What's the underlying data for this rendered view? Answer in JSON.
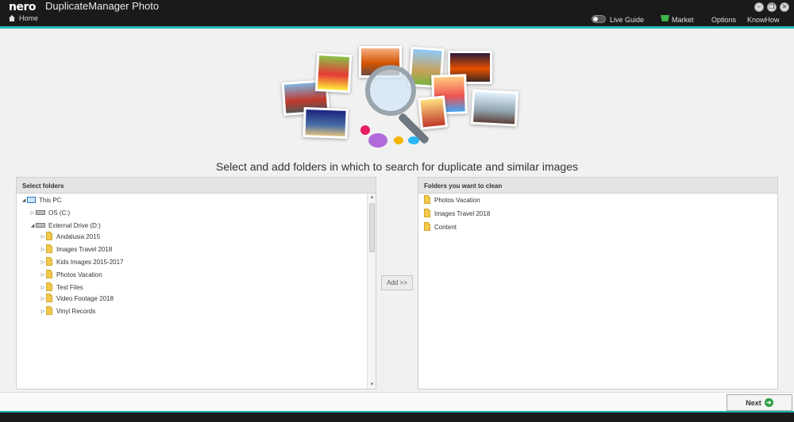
{
  "app": {
    "brand": "nero",
    "title": "DuplicateManager Photo",
    "home_label": "Home"
  },
  "menu": {
    "live_guide": "Live Guide",
    "market": "Market",
    "options": "Options",
    "knowhow": "KnowHow"
  },
  "window_controls": {
    "minimize": "–",
    "restore": "❐",
    "close": "✕"
  },
  "headline": "Select and add folders in which to search for duplicate and similar images",
  "left_panel": {
    "title": "Select folders",
    "tree": [
      {
        "label": "This PC",
        "icon": "computer-icon"
      },
      {
        "label": "OS (C:)",
        "icon": "drive-icon"
      },
      {
        "label": "External Drive (D:)",
        "icon": "drive-icon"
      },
      {
        "label": "Andalusia 2015",
        "icon": "folder-icon"
      },
      {
        "label": "Images Travel 2018",
        "icon": "folder-icon"
      },
      {
        "label": "Kids Images 2015-2017",
        "icon": "folder-icon"
      },
      {
        "label": "Photos Vacation",
        "icon": "folder-icon"
      },
      {
        "label": "Test Files",
        "icon": "folder-icon"
      },
      {
        "label": "Video Footage 2018",
        "icon": "folder-icon"
      },
      {
        "label": "Vinyl Records",
        "icon": "folder-icon"
      }
    ]
  },
  "add_button": "Add >>",
  "right_panel": {
    "title": "Folders you want to clean",
    "items": [
      {
        "label": "Photos Vacation"
      },
      {
        "label": "Images Travel 2018"
      },
      {
        "label": "Content"
      }
    ]
  },
  "footer": {
    "next_label": "Next"
  },
  "colors": {
    "accent": "#1fb8b6",
    "titlebar": "#1a1a1a",
    "folder": "#f2c94c",
    "next_green": "#2f9e44"
  }
}
